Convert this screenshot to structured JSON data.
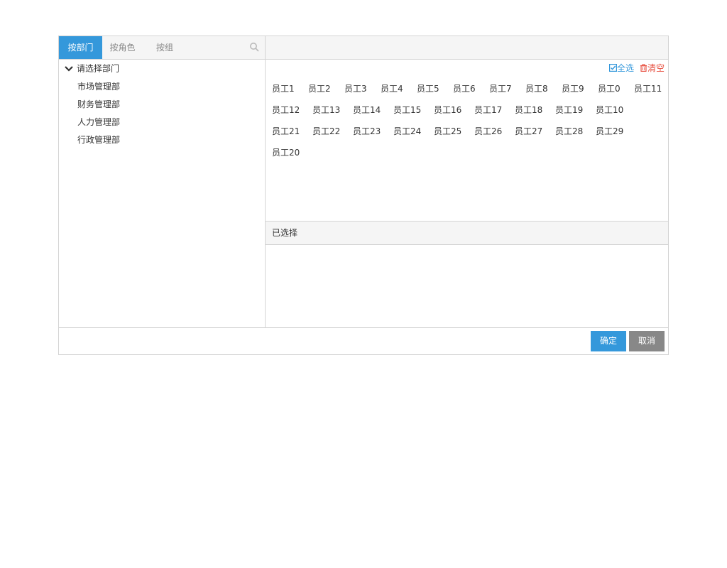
{
  "tabs": [
    {
      "label": "按部门"
    },
    {
      "label": "按角色"
    },
    {
      "label": "按组"
    }
  ],
  "tree": {
    "root_label": "请选择部门",
    "items": [
      "市场管理部",
      "财务管理部",
      "人力管理部",
      "行政管理部"
    ]
  },
  "actions": {
    "select_all": "全选",
    "clear": "清空"
  },
  "employees": {
    "row1": [
      "员工1",
      "员工2",
      "员工3",
      "员工4",
      "员工5",
      "员工6",
      "员工7",
      "员工8",
      "员工9",
      "员工0",
      "员工11"
    ],
    "row2": [
      "员工12",
      "员工13",
      "员工14",
      "员工15",
      "员工16",
      "员工17",
      "员工18",
      "员工19",
      "员工10"
    ],
    "row3": [
      "员工21",
      "员工22",
      "员工23",
      "员工24",
      "员工25",
      "员工26",
      "员工27",
      "员工28",
      "员工29"
    ],
    "row4": [
      "员工20"
    ]
  },
  "selected": {
    "title": "已选择"
  },
  "footer": {
    "ok_label": "确定",
    "cancel_label": "取消"
  },
  "colors": {
    "accent": "#3498db",
    "danger": "#e74c3c",
    "muted_button": "#888888",
    "border": "#d4d4d4",
    "header_bg": "#f5f5f5"
  },
  "icons": {
    "search": "search-icon",
    "expand": "chevron-down-icon",
    "select_all": "checkbox-checked-icon",
    "clear": "trash-icon"
  }
}
